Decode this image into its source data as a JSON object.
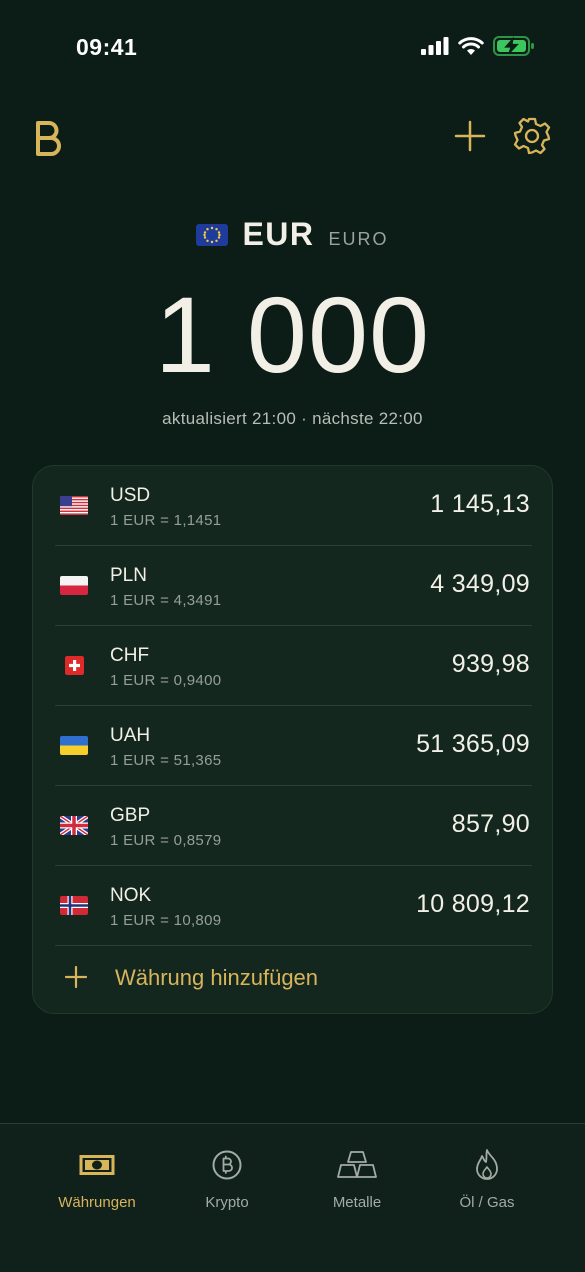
{
  "status": {
    "time": "09:41"
  },
  "colors": {
    "accent": "#d8b45b",
    "background": "#0c1c16",
    "card": "#13271f"
  },
  "base": {
    "code": "EUR",
    "name": "EURO",
    "amount": "1 000",
    "flag": "eu-flag"
  },
  "updated_text": "aktualisiert 21:00 · nächste 22:00",
  "rates": [
    {
      "code": "USD",
      "rate": "1 EUR = 1,1451",
      "value": "1 145,13",
      "flag": "us-flag"
    },
    {
      "code": "PLN",
      "rate": "1 EUR = 4,3491",
      "value": "4 349,09",
      "flag": "pl-flag"
    },
    {
      "code": "CHF",
      "rate": "1 EUR = 0,9400",
      "value": "939,98",
      "flag": "ch-flag"
    },
    {
      "code": "UAH",
      "rate": "1 EUR = 51,365",
      "value": "51 365,09",
      "flag": "ua-flag"
    },
    {
      "code": "GBP",
      "rate": "1 EUR = 0,8579",
      "value": "857,90",
      "flag": "gb-flag"
    },
    {
      "code": "NOK",
      "rate": "1 EUR = 10,809",
      "value": "10 809,12",
      "flag": "no-flag"
    }
  ],
  "add_currency_label": "Währung hinzufügen",
  "tabs": [
    {
      "label": "Währungen",
      "icon": "banknote-icon",
      "active": true
    },
    {
      "label": "Krypto",
      "icon": "bitcoin-icon",
      "active": false
    },
    {
      "label": "Metalle",
      "icon": "gold-bars-icon",
      "active": false
    },
    {
      "label": "Öl / Gas",
      "icon": "flame-icon",
      "active": false
    }
  ]
}
